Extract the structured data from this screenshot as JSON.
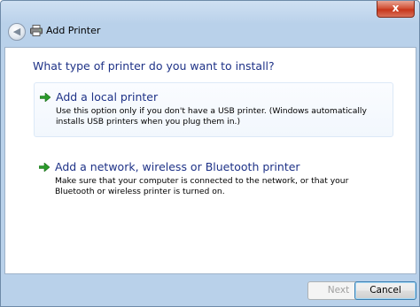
{
  "window": {
    "title": "Add Printer",
    "close_glyph": "x"
  },
  "nav": {
    "back_glyph": "◀"
  },
  "main": {
    "question": "What type of printer do you want to install?",
    "options": [
      {
        "title": "Add a local printer",
        "description": "Use this option only if you don't have a USB printer. (Windows automatically installs USB printers when you plug them in.)",
        "icon": "green-arrow-icon"
      },
      {
        "title": "Add a network, wireless or Bluetooth printer",
        "description": "Make sure that your computer is connected to the network, or that your Bluetooth or wireless printer is turned on.",
        "icon": "green-arrow-icon"
      }
    ]
  },
  "footer": {
    "next_label": "Next",
    "cancel_label": "Cancel"
  },
  "colors": {
    "heading": "#1e3287",
    "frame": "#b9d1ea",
    "arrow": "#2a9a2a"
  }
}
